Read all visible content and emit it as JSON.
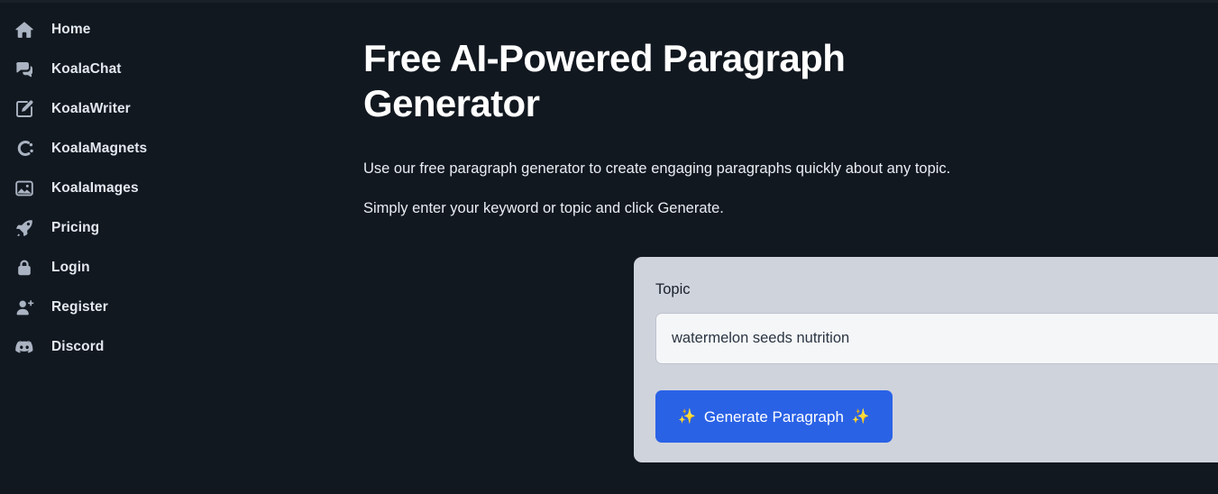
{
  "theme": {
    "page_bg": "#121820",
    "sidebar_bg": "#121820",
    "card_bg": "#cfd3dc",
    "input_bg": "#f5f6f8",
    "accent_button": "#2a62e6",
    "sparkle_gold": "#f5a623",
    "nav_text": "#e3e8ef",
    "nav_icon": "#aab4c2",
    "heading_text": "#ffffff"
  },
  "sidebar": {
    "items": [
      {
        "label": "Home",
        "icon": "home-icon"
      },
      {
        "label": "KoalaChat",
        "icon": "chat-bubbles-icon"
      },
      {
        "label": "KoalaWriter",
        "icon": "pencil-square-icon"
      },
      {
        "label": "KoalaMagnets",
        "icon": "magnet-icon"
      },
      {
        "label": "KoalaImages",
        "icon": "image-icon"
      },
      {
        "label": "Pricing",
        "icon": "rocket-icon"
      },
      {
        "label": "Login",
        "icon": "lock-icon"
      },
      {
        "label": "Register",
        "icon": "user-plus-icon"
      },
      {
        "label": "Discord",
        "icon": "discord-icon"
      }
    ]
  },
  "main": {
    "title": "Free AI-Powered Paragraph Generator",
    "paragraph_1": "Use our free paragraph generator to create engaging paragraphs quickly about any topic.",
    "paragraph_2": "Simply enter your keyword or topic and click Generate."
  },
  "form": {
    "topic_label": "Topic",
    "topic_value": "watermelon seeds nutrition",
    "topic_placeholder": "",
    "generate_label": "Generate Paragraph",
    "sparkle_left": "✨",
    "sparkle_right": "✨"
  }
}
